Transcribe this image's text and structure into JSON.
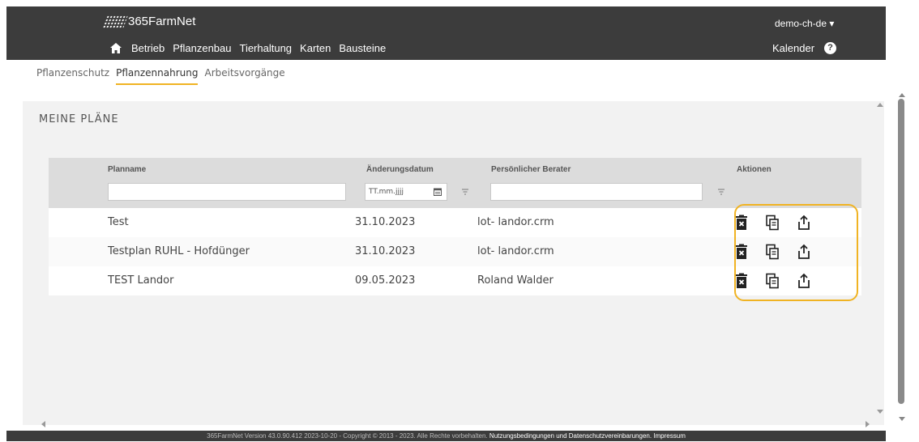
{
  "header": {
    "brand": "365FarmNet",
    "user": "demo-ch-de ▾",
    "nav": [
      "Betrieb",
      "Pflanzenbau",
      "Tierhaltung",
      "Karten",
      "Bausteine"
    ],
    "calendar": "Kalender",
    "help": "?"
  },
  "subtabs": [
    {
      "label": "Pflanzenschutz",
      "active": false
    },
    {
      "label": "Pflanzennahrung",
      "active": true
    },
    {
      "label": "Arbeitsvorgänge",
      "active": false
    }
  ],
  "panel": {
    "title": "MEINE PLÄNE"
  },
  "table": {
    "columns": [
      "Planname",
      "Änderungsdatum",
      "Persönlicher Berater",
      "Aktionen"
    ],
    "date_placeholder": "TT.mm.jjjj",
    "rows": [
      {
        "name": "Test",
        "date": "31.10.2023",
        "advisor": "lot- landor.crm"
      },
      {
        "name": "Testplan RUHL - Hofdünger",
        "date": "31.10.2023",
        "advisor": "lot- landor.crm"
      },
      {
        "name": "TEST Landor",
        "date": "09.05.2023",
        "advisor": "Roland Walder"
      }
    ]
  },
  "icons": {
    "delete": "trash-icon",
    "copy": "copy-icon",
    "export": "share-export-icon"
  },
  "colors": {
    "accent": "#f0b323",
    "topbar": "#3c3c3c"
  },
  "footer": {
    "text": "365FarmNet Version 43.0.90.412 2023-10-20 - Copyright © 2013 - 2023. Alle Rechte vorbehalten.",
    "links": "Nutzungsbedingungen und Datenschutzvereinbarungen. Impressum"
  }
}
